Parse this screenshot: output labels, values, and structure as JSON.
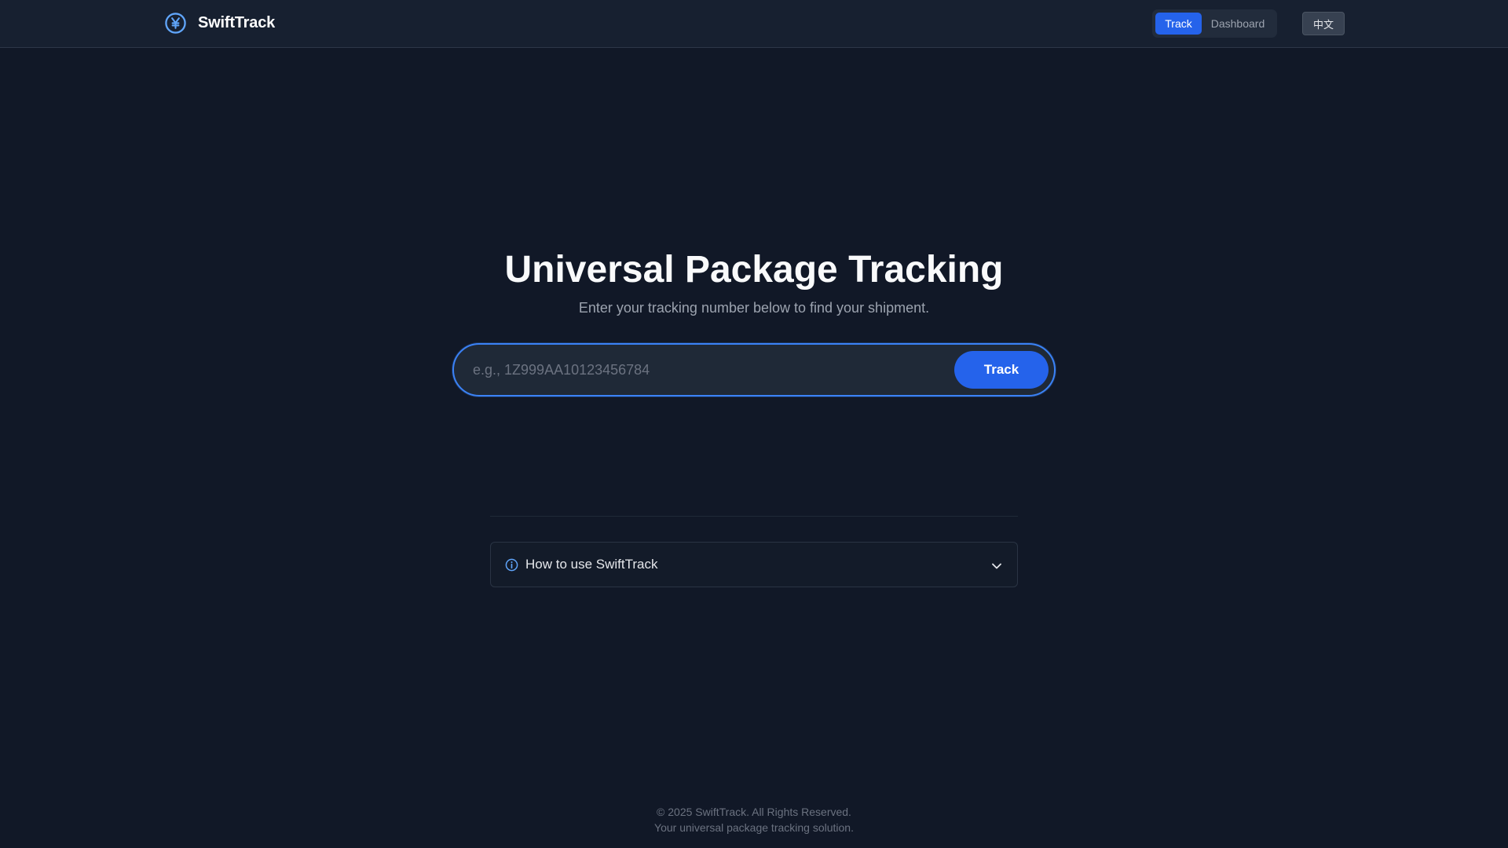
{
  "header": {
    "brand_name": "SwiftTrack",
    "brand_icon": "yen-circle-icon",
    "nav": {
      "track_label": "Track",
      "dashboard_label": "Dashboard",
      "active": "Track"
    },
    "language_button": "中文"
  },
  "hero": {
    "title": "Universal Package Tracking",
    "subtitle": "Enter your tracking number below to find your shipment."
  },
  "search": {
    "value": "",
    "placeholder": "e.g., 1Z999AA10123456784",
    "button_label": "Track"
  },
  "help": {
    "label": "How to use SwiftTrack",
    "icon": "info-icon",
    "expanded": false
  },
  "footer": {
    "copyright": "© 2025 SwiftTrack. All Rights Reserved.",
    "tagline": "Your universal package tracking solution."
  },
  "colors": {
    "background": "#111827",
    "header": "#172030",
    "accent": "#2563eb",
    "accent_border": "#3b82f6"
  }
}
